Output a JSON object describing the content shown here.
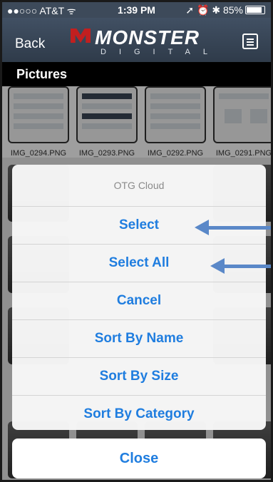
{
  "status": {
    "carrier": "●●○○○ AT&T ᯤ",
    "time": "1:39 PM",
    "right": "➚ ⏰ ✱ 85%"
  },
  "nav": {
    "back": "Back",
    "logo_word": "MONSTER",
    "logo_sub": "DIGITAL"
  },
  "title": "Pictures",
  "thumbs": [
    "IMG_0294.PNG",
    "IMG_0293.PNG",
    "IMG_0292.PNG",
    "IMG_0291.PNG"
  ],
  "sheet": {
    "title": "OTG Cloud",
    "options": [
      "Select",
      "Select All",
      "Cancel",
      "Sort By Name",
      "Sort By Size",
      "Sort By Category"
    ],
    "close": "Close"
  },
  "colors": {
    "accent": "#1f7ddf",
    "arrow": "#5a88c8",
    "navbar": "#3d4a5a"
  }
}
